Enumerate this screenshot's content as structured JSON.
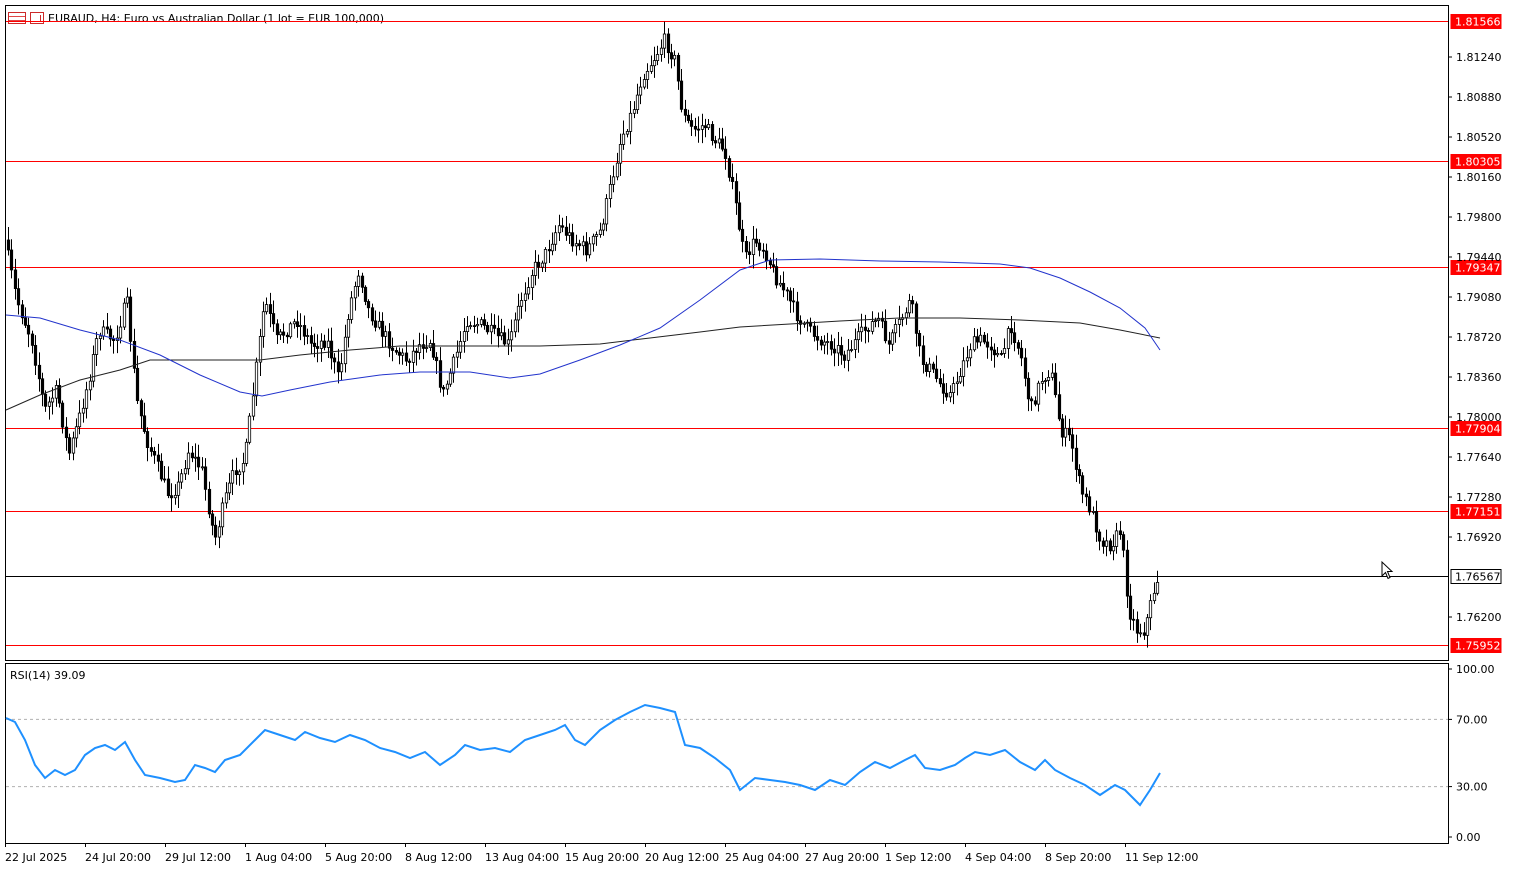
{
  "chart": {
    "header_title": "EURAUD, H4:  Euro vs Australian Dollar (1 lot = EUR 100,000)",
    "price_axis_labels": [
      "1.81240",
      "1.80880",
      "1.80520",
      "1.80160",
      "1.79800",
      "1.79440",
      "1.79080",
      "1.78720",
      "1.78360",
      "1.78000",
      "1.77640",
      "1.77280",
      "1.76920",
      "1.76200"
    ],
    "time_axis_labels": [
      "22 Jul 2025",
      "24 Jul 20:00",
      "29 Jul 12:00",
      "1 Aug 04:00",
      "5 Aug 20:00",
      "8 Aug 12:00",
      "13 Aug 04:00",
      "15 Aug 20:00",
      "20 Aug 12:00",
      "25 Aug 04:00",
      "27 Aug 20:00",
      "1 Sep 12:00",
      "4 Sep 04:00",
      "8 Sep 20:00",
      "11 Sep 12:00"
    ],
    "horizontal_levels": [
      {
        "label": "1.81566",
        "color": "#ff0000"
      },
      {
        "label": "1.80305",
        "color": "#ff0000"
      },
      {
        "label": "1.79347",
        "color": "#ff0000"
      },
      {
        "label": "1.77904",
        "color": "#ff0000"
      },
      {
        "label": "1.77151",
        "color": "#ff0000"
      },
      {
        "label": "1.75952",
        "color": "#ff0000"
      }
    ],
    "current_price": {
      "label": "1.76567",
      "color": "#000000"
    },
    "ma_colors": {
      "fast": "#2233cc",
      "slow": "#222222"
    }
  },
  "rsi": {
    "title": "RSI(14) 39.09",
    "axis_labels": [
      "100.00",
      "70.00",
      "30.00",
      "0.00"
    ],
    "line_color": "#1e90ff"
  }
}
